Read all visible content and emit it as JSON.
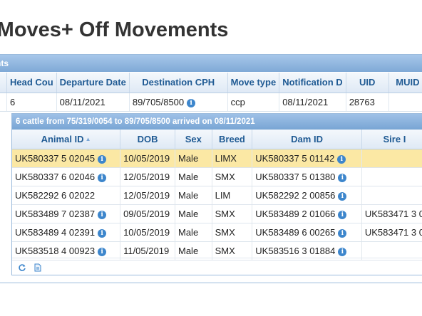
{
  "page_title": "tMoves+ Off Movements",
  "panel_title": "nts",
  "main_table": {
    "columns": [
      "Head Cou",
      "Departure Date",
      "Destination CPH",
      "Move type",
      "Notification D",
      "UID",
      "MUID"
    ],
    "row": {
      "head_count": "6",
      "departure_date": "08/11/2021",
      "destination_cph": "89/705/8500",
      "move_type": "ccp",
      "notification_date": "08/11/2021",
      "uid": "28763",
      "muid": ""
    }
  },
  "sub_panel": {
    "title": "6 cattle from 75/319/0054 to 89/705/8500 arrived on 08/11/2021",
    "columns": [
      "Animal ID",
      "DOB",
      "Sex",
      "Breed",
      "Dam ID",
      "Sire I"
    ],
    "rows": [
      {
        "animal_id": "UK580337 5 02045",
        "dob": "10/05/2019",
        "sex": "Male",
        "breed": "LIMX",
        "dam_id": "UK580337 5 01142",
        "sire_id": ""
      },
      {
        "animal_id": "UK580337 6 02046",
        "dob": "12/05/2019",
        "sex": "Male",
        "breed": "SMX",
        "dam_id": "UK580337 5 01380",
        "sire_id": ""
      },
      {
        "animal_id": "UK582292 6 02022",
        "dob": "12/05/2019",
        "sex": "Male",
        "breed": "LIM",
        "dam_id": "UK582292 2 00856",
        "sire_id": ""
      },
      {
        "animal_id": "UK583489 7 02387",
        "dob": "09/05/2019",
        "sex": "Male",
        "breed": "SMX",
        "dam_id": "UK583489 2 01066",
        "sire_id": "UK583471 3 0"
      },
      {
        "animal_id": "UK583489 4 02391",
        "dob": "10/05/2019",
        "sex": "Male",
        "breed": "SMX",
        "dam_id": "UK583489 6 00265",
        "sire_id": "UK583471 3 0"
      },
      {
        "animal_id": "UK583518 4 00923",
        "dob": "11/05/2019",
        "sex": "Male",
        "breed": "SMX",
        "dam_id": "UK583516 3 01884",
        "sire_id": ""
      }
    ]
  },
  "icons": {
    "info": "info-icon",
    "refresh": "refresh-icon",
    "export": "export-icon",
    "sort": "sort-ascending-icon"
  },
  "colors": {
    "header_blue": "#7fa9d6",
    "column_text": "#1f5a93",
    "selected_row": "#fbe8a4",
    "info_icon": "#3d86cc"
  },
  "selected_row_index": 0
}
